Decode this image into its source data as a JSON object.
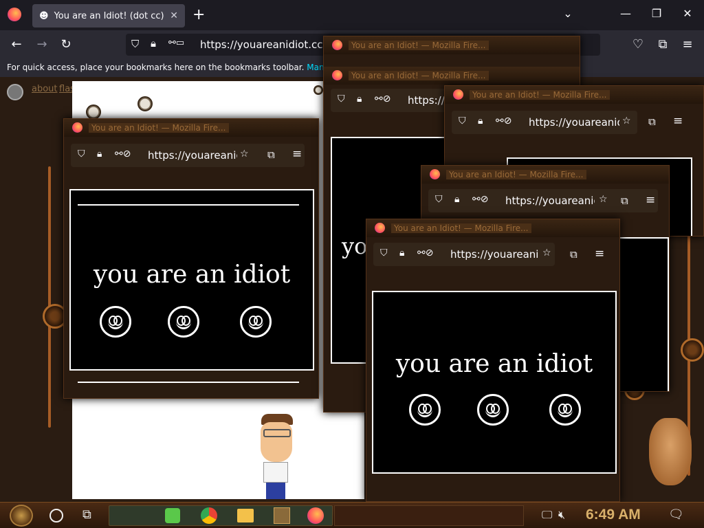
{
  "tab": {
    "title": "You are an Idiot! (dot cc)"
  },
  "url": "https://youareanidiot.cc",
  "bookmarks": {
    "text": "For quick access, place your bookmarks here on the bookmarks toolbar.",
    "link": "Manage bo"
  },
  "page_links": {
    "about": "about",
    "flash": "flash"
  },
  "popups": {
    "title": "You are an Idiot! — Mozilla Fire...",
    "url_short": "https://youareanidio",
    "url_tiny": "https://",
    "message": "you are an idiot",
    "message_clipped": "yo"
  },
  "taskbar": {
    "time": "6:49 AM"
  }
}
